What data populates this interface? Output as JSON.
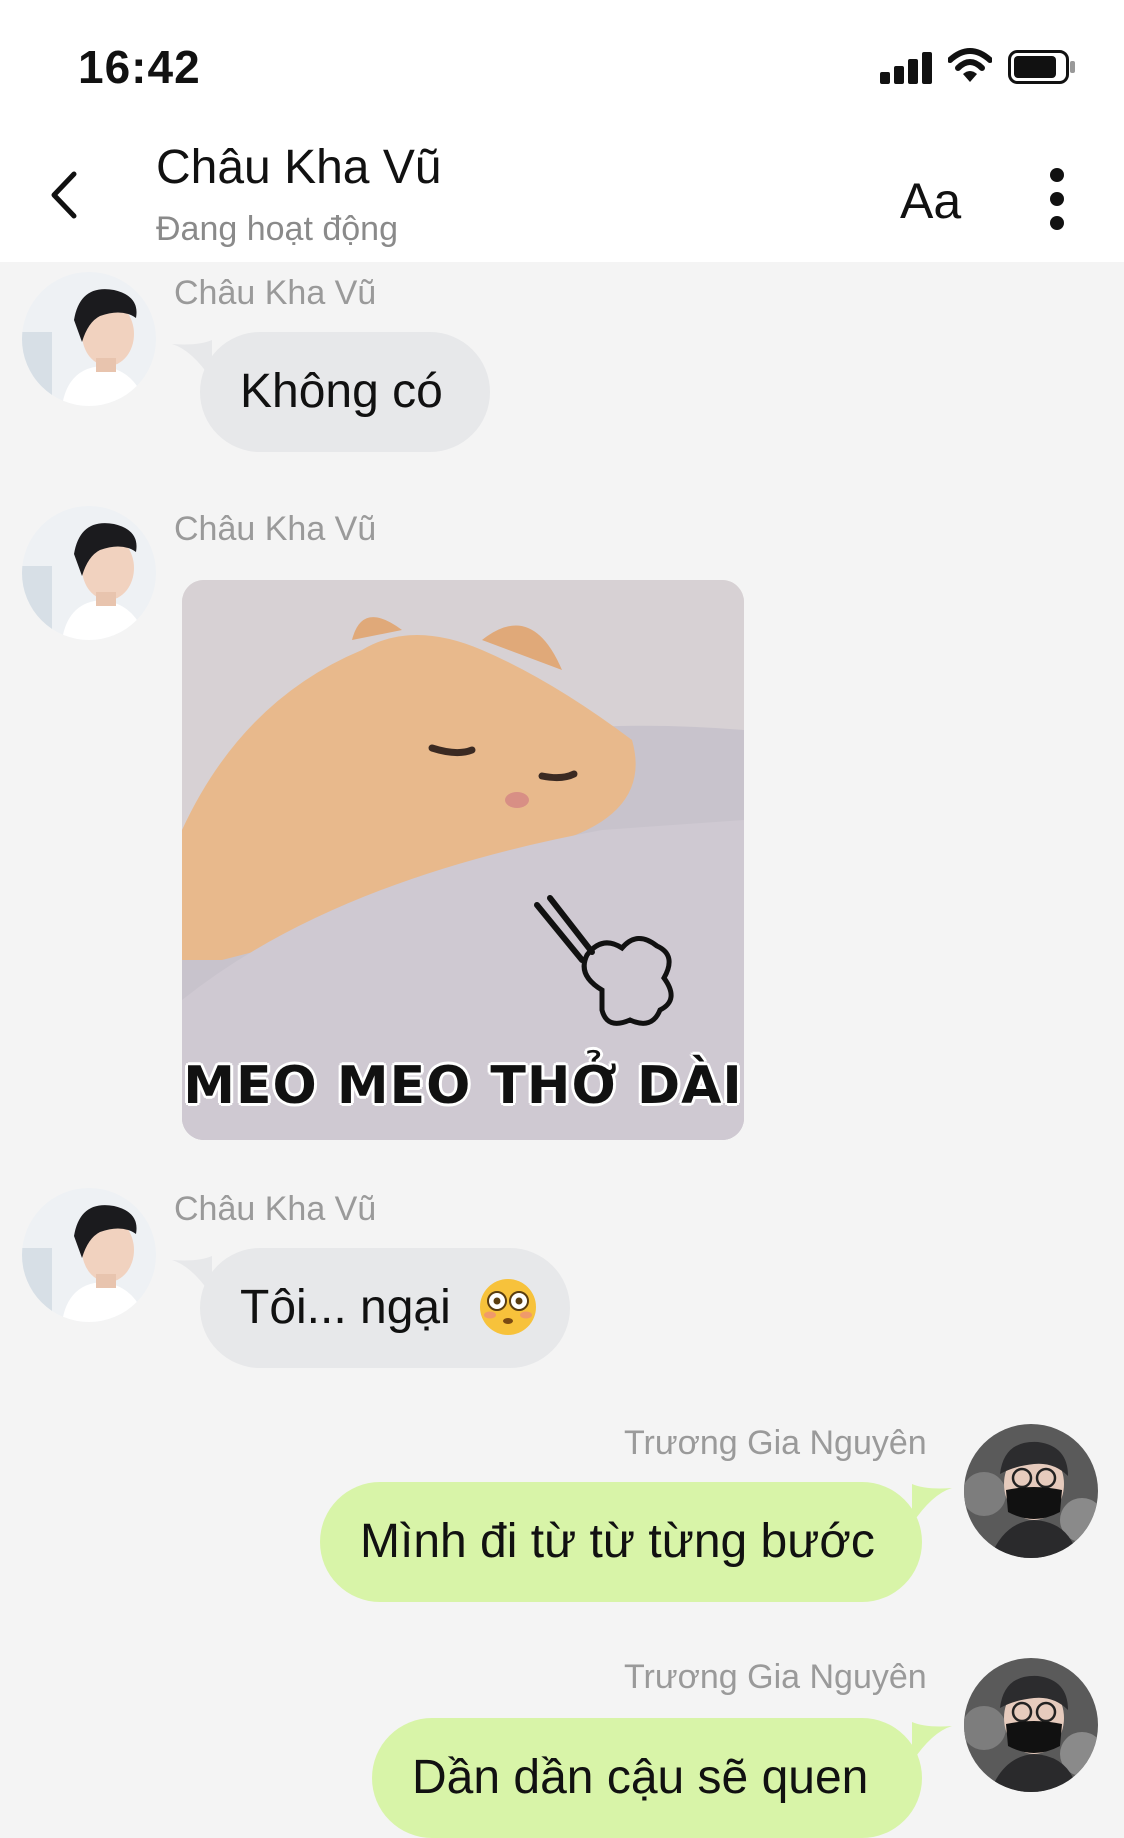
{
  "status_bar": {
    "time": "16:42",
    "signal_icon": "cellular-signal-icon",
    "wifi_icon": "wifi-icon",
    "battery_icon": "battery-icon"
  },
  "header": {
    "back_icon": "chevron-left-icon",
    "contact_name": "Châu Kha Vũ",
    "contact_status": "Đang hoạt động",
    "font_button_label": "Aa",
    "more_icon": "vertical-dots-icon"
  },
  "messages": [
    {
      "direction": "incoming",
      "sender": "Châu Kha Vũ",
      "type": "text",
      "text": "Không có"
    },
    {
      "direction": "incoming",
      "sender": "Châu Kha Vũ",
      "type": "sticker",
      "caption": "MEO MEO THỞ DÀI"
    },
    {
      "direction": "incoming",
      "sender": "Châu Kha Vũ",
      "type": "text",
      "text": "Tôi... ngại",
      "emoji": "flushed-face-icon"
    },
    {
      "direction": "outgoing",
      "sender": "Trương Gia Nguyên",
      "type": "text",
      "text": "Mình đi từ từ từng bước"
    },
    {
      "direction": "outgoing",
      "sender": "Trương Gia Nguyên",
      "type": "text",
      "text": "Dần dần cậu sẽ quen"
    }
  ],
  "colors": {
    "incoming_bubble": "#e7e8ea",
    "outgoing_bubble": "#d8f4a8",
    "chat_background": "#f4f4f4"
  }
}
